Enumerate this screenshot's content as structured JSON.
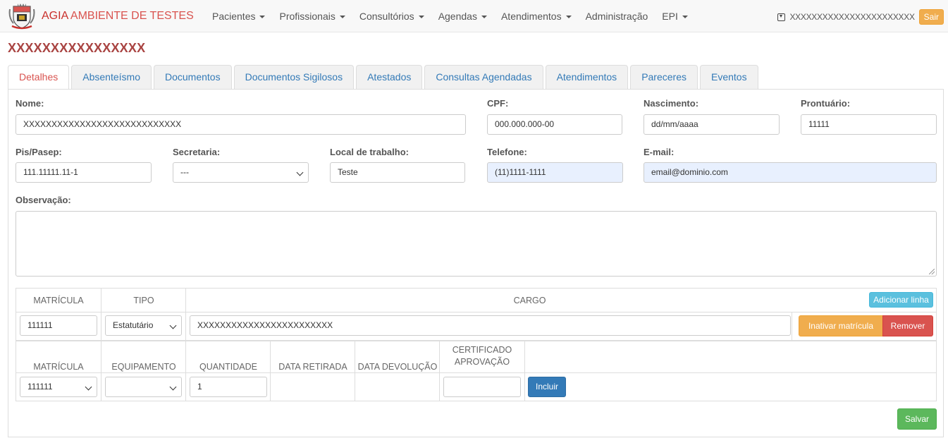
{
  "navbar": {
    "brand_prefix": "AGIA",
    "brand_suffix": "AMBIENTE DE TESTES",
    "menu": [
      {
        "label": "Pacientes",
        "dropdown": true
      },
      {
        "label": "Profissionais",
        "dropdown": true
      },
      {
        "label": "Consultórios",
        "dropdown": true
      },
      {
        "label": "Agendas",
        "dropdown": true
      },
      {
        "label": "Atendimentos",
        "dropdown": true
      },
      {
        "label": "Administração",
        "dropdown": false
      },
      {
        "label": "EPI",
        "dropdown": true
      }
    ],
    "user_name": "XXXXXXXXXXXXXXXXXXXXXXX",
    "logout_label": "Sair"
  },
  "page": {
    "title": "XXXXXXXXXXXXXXXX",
    "tabs": [
      "Detalhes",
      "Absenteísmo",
      "Documentos",
      "Documentos Sigilosos",
      "Atestados",
      "Consultas Agendadas",
      "Atendimentos",
      "Pareceres",
      "Eventos"
    ],
    "active_tab": "Detalhes"
  },
  "form": {
    "nome_label": "Nome:",
    "nome_value": "XXXXXXXXXXXXXXXXXXXXXXXXXXXX",
    "cpf_label": "CPF:",
    "cpf_value": "000.000.000-00",
    "nascimento_label": "Nascimento:",
    "nascimento_value": "dd/mm/aaaa",
    "prontuario_label": "Prontuário:",
    "prontuario_value": "11111",
    "pis_label": "Pis/Pasep:",
    "pis_value": "111.11111.11-1",
    "secretaria_label": "Secretaria:",
    "secretaria_value": "---",
    "local_label": "Local de trabalho:",
    "local_value": "Teste",
    "telefone_label": "Telefone:",
    "telefone_value": "(11)1111-1111",
    "email_label": "E-mail:",
    "email_value": "email@dominio.com",
    "observacao_label": "Observação:",
    "observacao_value": ""
  },
  "matricula_table": {
    "headers": [
      "MATRÍCULA",
      "TIPO",
      "CARGO"
    ],
    "add_button": "Adicionar linha",
    "row": {
      "matricula": "111111",
      "tipo": "Estatutário",
      "cargo": "XXXXXXXXXXXXXXXXXXXXXXXX",
      "inactivate_button": "Inativar matrícula",
      "remove_button": "Remover"
    }
  },
  "epi_table": {
    "headers": [
      "MATRÍCULA",
      "EQUIPAMENTO",
      "QUANTIDADE",
      "DATA RETIRADA",
      "DATA DEVOLUÇÃO",
      "CERTIFICADO",
      "APROVAÇÃO"
    ],
    "row": {
      "matricula": "111111",
      "equipamento": "",
      "quantidade": "1",
      "certificado": "",
      "include_button": "Incluir"
    }
  },
  "save_button": "Salvar",
  "colors": {
    "brand": "#c9302c",
    "title": "#a94442",
    "link": "#337ab7",
    "warning": "#f0ad4e",
    "danger": "#d9534f",
    "primary": "#337ab7",
    "success": "#5cb85c",
    "info": "#5bc0de"
  }
}
